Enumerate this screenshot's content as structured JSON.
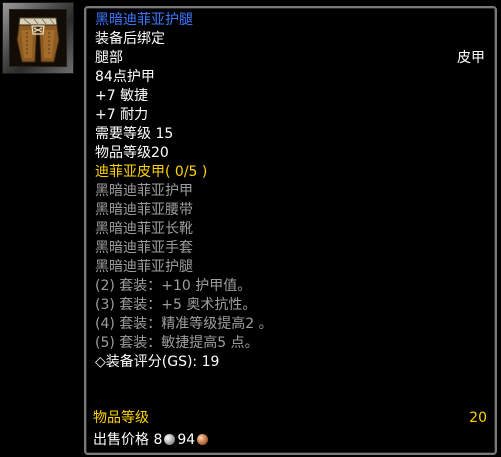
{
  "icon": {
    "name": "leather-leggings-icon"
  },
  "tooltip": {
    "item_name": "黑暗迪菲亚护腿",
    "bind": "装备后绑定",
    "slot": "腿部",
    "armor_type": "皮甲",
    "armor": "84点护甲",
    "stat_agility": "+7 敏捷",
    "stat_stamina": "+7 耐力",
    "required_level": "需要等级 15",
    "item_level_text": "物品等级20",
    "set_name": "迪菲亚皮甲",
    "set_count": "( 0/5 )",
    "set_pieces": [
      "黑暗迪菲亚护甲",
      "黑暗迪菲亚腰带",
      "黑暗迪菲亚长靴",
      "黑暗迪菲亚手套",
      "黑暗迪菲亚护腿"
    ],
    "set_bonuses": [
      "(2) 套装：+10 护甲值。",
      "(3) 套装：+5 奥术抗性。",
      "(4) 套装：精准等级提高2 。",
      "(5) 套装：敏捷提高5 点。"
    ],
    "gear_score": "◇装备评分(GS): 19",
    "item_level_label": "物品等级",
    "item_level_value": "20",
    "sell_label": "出售价格",
    "sell_silver": "8",
    "sell_copper": "94"
  },
  "colors": {
    "name": "#3b78ff",
    "white": "#ffffff",
    "set_header": "#ffd200",
    "inactive": "#9d9d9d",
    "border": "#7a7a7a"
  }
}
